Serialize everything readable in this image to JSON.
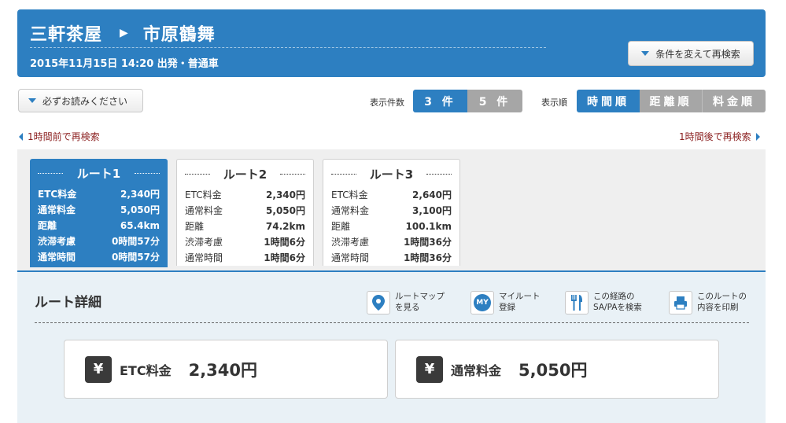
{
  "header": {
    "from": "三軒茶屋",
    "arrow": "▶",
    "to": "市原鶴舞",
    "subtitle": "2015年11月15日 14:20 出発・普通車",
    "retry_label": "条件を変えて再検索"
  },
  "read_first_label": "必ずお読みください",
  "display_count": {
    "label": "表示件数",
    "options": [
      "3 件",
      "5 件"
    ],
    "selected": "3 件"
  },
  "display_order": {
    "label": "表示順",
    "options": [
      "時間順",
      "距離順",
      "料金順"
    ],
    "selected": "時間順"
  },
  "nav": {
    "prev_label": "1時間前で再検索",
    "next_label": "1時間後で再検索"
  },
  "routes": [
    {
      "title": "ルート1",
      "rows": [
        {
          "k": "ETC料金",
          "v": "2,340円"
        },
        {
          "k": "通常料金",
          "v": "5,050円"
        },
        {
          "k": "距離",
          "v": "65.4km"
        },
        {
          "k": "渋滞考慮",
          "v": "0時間57分"
        },
        {
          "k": "通常時間",
          "v": "0時間57分"
        }
      ]
    },
    {
      "title": "ルート2",
      "rows": [
        {
          "k": "ETC料金",
          "v": "2,340円"
        },
        {
          "k": "通常料金",
          "v": "5,050円"
        },
        {
          "k": "距離",
          "v": "74.2km"
        },
        {
          "k": "渋滞考慮",
          "v": "1時間6分"
        },
        {
          "k": "通常時間",
          "v": "1時間6分"
        }
      ]
    },
    {
      "title": "ルート3",
      "rows": [
        {
          "k": "ETC料金",
          "v": "2,640円"
        },
        {
          "k": "通常料金",
          "v": "3,100円"
        },
        {
          "k": "距離",
          "v": "100.1km"
        },
        {
          "k": "渋滞考慮",
          "v": "1時間36分"
        },
        {
          "k": "通常時間",
          "v": "1時間36分"
        }
      ]
    }
  ],
  "detail": {
    "title": "ルート詳細",
    "actions": [
      {
        "icon": "map-pin-icon",
        "line1": "ルートマップ",
        "line2": "を見る"
      },
      {
        "icon": "my-icon",
        "badge": "MY",
        "line1": "マイルート",
        "line2": "登録"
      },
      {
        "icon": "fork-knife-icon",
        "line1": "この経路の",
        "line2": "SA/PAを検索"
      },
      {
        "icon": "printer-icon",
        "line1": "このルートの",
        "line2": "内容を印刷"
      }
    ],
    "etc": {
      "label": "ETC料金",
      "amount": "2,340円",
      "yen": "¥"
    },
    "normal": {
      "label": "通常料金",
      "amount": "5,050円",
      "yen": "¥"
    }
  },
  "colors": {
    "primary": "#2d7fc1",
    "inactive": "#a6a6a6",
    "link": "#8b1f1f"
  }
}
